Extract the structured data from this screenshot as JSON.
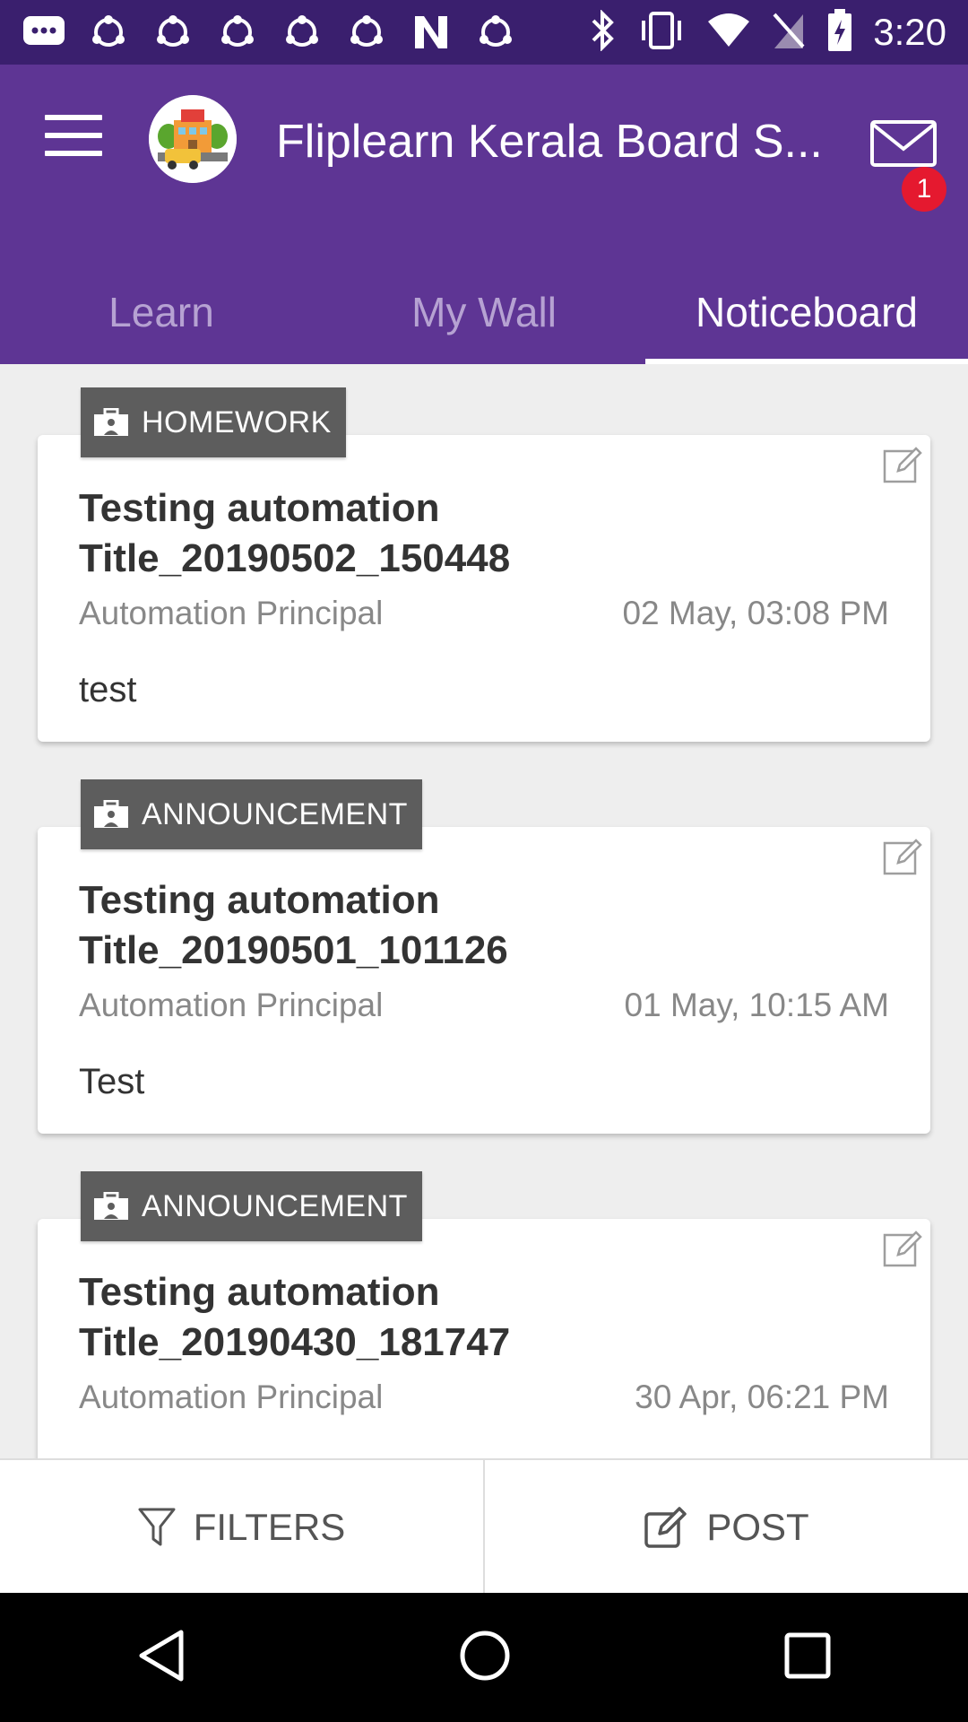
{
  "status_bar": {
    "time": "3:20",
    "left_icons": [
      "chat-icon",
      "sync-icon",
      "sync-icon",
      "sync-icon",
      "sync-icon",
      "sync-icon",
      "n-logo-icon",
      "sync-icon"
    ],
    "right_icons": [
      "bluetooth-icon",
      "vibrate-icon",
      "wifi-icon",
      "no-sim-icon",
      "battery-charging-icon"
    ]
  },
  "app_bar": {
    "title": "Fliplearn Kerala Board S...",
    "mail_badge_count": "1",
    "bg_color": "#5e3594"
  },
  "tabs": [
    {
      "label": "Learn",
      "active": false
    },
    {
      "label": "My Wall",
      "active": false
    },
    {
      "label": "Noticeboard",
      "active": true
    }
  ],
  "notices": [
    {
      "tag": "HOMEWORK",
      "title": "Testing automation Title_20190502_150448",
      "author": "Automation Principal",
      "date": "02 May, 03:08 PM",
      "body": "test"
    },
    {
      "tag": "ANNOUNCEMENT",
      "title": "Testing automation Title_20190501_101126",
      "author": "Automation Principal",
      "date": "01 May, 10:15 AM",
      "body": "Test"
    },
    {
      "tag": "ANNOUNCEMENT",
      "title": "Testing automation Title_20190430_181747",
      "author": "Automation Principal",
      "date": "30 Apr, 06:21 PM",
      "body": ""
    }
  ],
  "bottom_bar": {
    "filters_label": "FILTERS",
    "post_label": "POST"
  }
}
